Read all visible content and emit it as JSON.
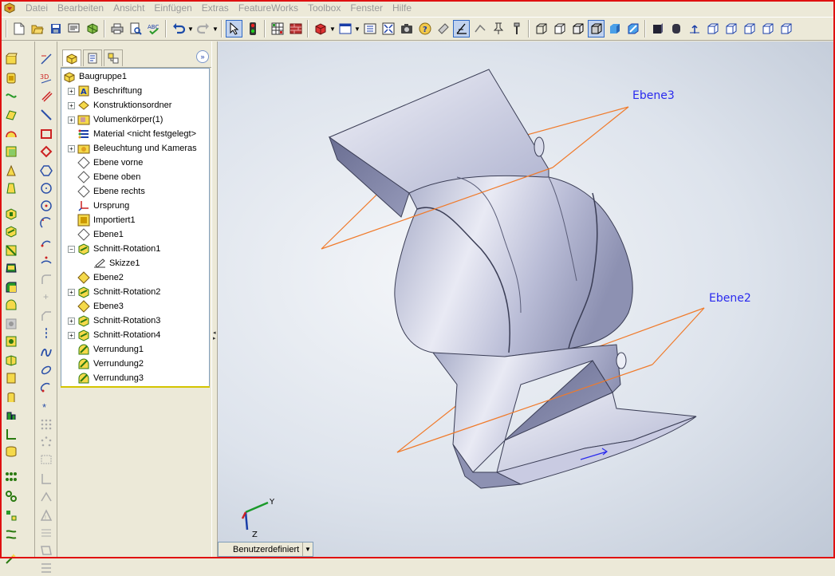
{
  "menubar": {
    "app_icon": "solidworks-logo-icon",
    "items": [
      "Datei",
      "Bearbeiten",
      "Ansicht",
      "Einfügen",
      "Extras",
      "FeatureWorks",
      "Toolbox",
      "Fenster",
      "Hilfe"
    ]
  },
  "toolbar": {
    "icons": [
      "new-document-icon",
      "open-icon",
      "save-icon",
      "print-icon",
      "print-preview-icon",
      "spell-check-icon",
      "undo-icon",
      "redo-icon",
      "select-icon",
      "traffic-light-icon",
      "grid-icon",
      "brick-icon",
      "3d-box-icon",
      "window-icon",
      "list-icon",
      "zoom-fit-icon",
      "camera-icon",
      "help-icon",
      "dimension-icon",
      "view-orientation-icons"
    ]
  },
  "feature_manager": {
    "expand_icon": "double-chevron-right-icon",
    "tree": [
      {
        "label": "Baugruppe1",
        "icon": "assembly-icon",
        "expand": "none",
        "indent": 0
      },
      {
        "label": "Beschriftung",
        "icon": "annotation-icon",
        "expand": "plus",
        "indent": 1
      },
      {
        "label": "Konstruktionsordner",
        "icon": "design-folder-icon",
        "expand": "plus",
        "indent": 1
      },
      {
        "label": "Volumenkörper(1)",
        "icon": "solid-body-icon",
        "expand": "plus",
        "indent": 1
      },
      {
        "label": "Material <nicht festgelegt>",
        "icon": "material-icon",
        "expand": "none",
        "indent": 1
      },
      {
        "label": "Beleuchtung und Kameras",
        "icon": "lighting-icon",
        "expand": "plus",
        "indent": 1
      },
      {
        "label": "Ebene vorne",
        "icon": "plane-icon",
        "expand": "none",
        "indent": 1
      },
      {
        "label": "Ebene oben",
        "icon": "plane-icon",
        "expand": "none",
        "indent": 1
      },
      {
        "label": "Ebene rechts",
        "icon": "plane-icon",
        "expand": "none",
        "indent": 1
      },
      {
        "label": "Ursprung",
        "icon": "origin-icon",
        "expand": "none",
        "indent": 1
      },
      {
        "label": "Importiert1",
        "icon": "imported-body-icon",
        "expand": "none",
        "indent": 1
      },
      {
        "label": "Ebene1",
        "icon": "plane-icon",
        "expand": "none",
        "indent": 1
      },
      {
        "label": "Schnitt-Rotation1",
        "icon": "cut-revolve-icon",
        "expand": "minus",
        "indent": 1
      },
      {
        "label": "Skizze1",
        "icon": "sketch-icon",
        "expand": "none",
        "indent": 2
      },
      {
        "label": "Ebene2",
        "icon": "plane-yellow-icon",
        "expand": "none",
        "indent": 1
      },
      {
        "label": "Schnitt-Rotation2",
        "icon": "cut-revolve-icon",
        "expand": "plus",
        "indent": 1
      },
      {
        "label": "Ebene3",
        "icon": "plane-yellow-icon",
        "expand": "none",
        "indent": 1
      },
      {
        "label": "Schnitt-Rotation3",
        "icon": "cut-revolve-icon",
        "expand": "plus",
        "indent": 1
      },
      {
        "label": "Schnitt-Rotation4",
        "icon": "cut-revolve-icon",
        "expand": "plus",
        "indent": 1
      },
      {
        "label": "Verrundung1",
        "icon": "fillet-icon",
        "expand": "none",
        "indent": 1
      },
      {
        "label": "Verrundung2",
        "icon": "fillet-icon",
        "expand": "none",
        "indent": 1
      },
      {
        "label": "Verrundung3",
        "icon": "fillet-icon",
        "expand": "none",
        "indent": 1
      }
    ]
  },
  "viewport": {
    "plane_labels": [
      "Ebene3",
      "Ebene2"
    ],
    "label_color": "#2a2aee",
    "plane_color": "#f07a2a",
    "triad_axes": [
      "Y",
      "Z"
    ]
  },
  "view_selector": {
    "label": "Benutzerdefiniert"
  }
}
